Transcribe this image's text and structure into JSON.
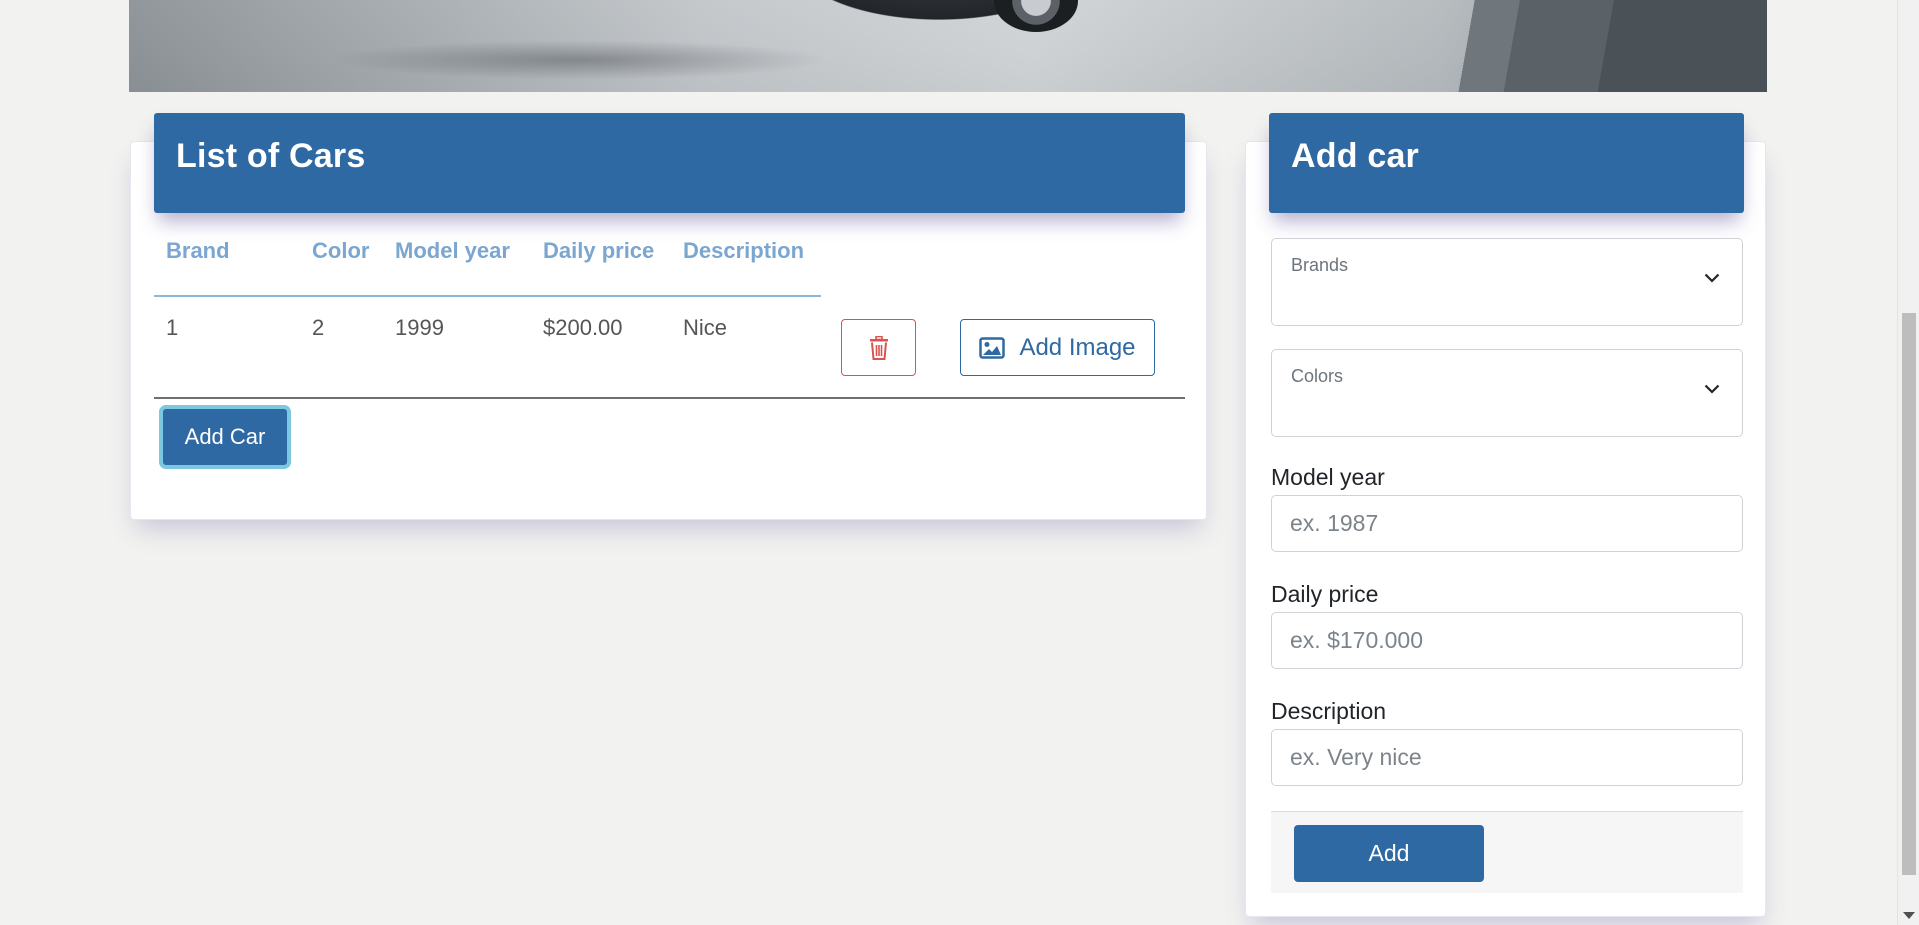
{
  "list_card": {
    "title": "List of Cars",
    "columns": [
      "Brand",
      "Color",
      "Model year",
      "Daily price",
      "Description"
    ],
    "rows": [
      {
        "brand": "1",
        "color": "2",
        "model_year": "1999",
        "daily_price": "$200.00",
        "description": "Nice"
      }
    ],
    "add_image_label": "Add Image",
    "add_car_label": "Add Car"
  },
  "add_card": {
    "title": "Add car",
    "brands_label": "Brands",
    "colors_label": "Colors",
    "model_year_label": "Model year",
    "model_year_placeholder": "ex. 1987",
    "daily_price_label": "Daily price",
    "daily_price_placeholder": "ex. $170.000",
    "description_label": "Description",
    "description_placeholder": "ex. Very nice",
    "submit_label": "Add"
  },
  "colors": {
    "primary": "#2f69a3",
    "danger": "#d9534f",
    "header_text": "#7aa6cf"
  }
}
